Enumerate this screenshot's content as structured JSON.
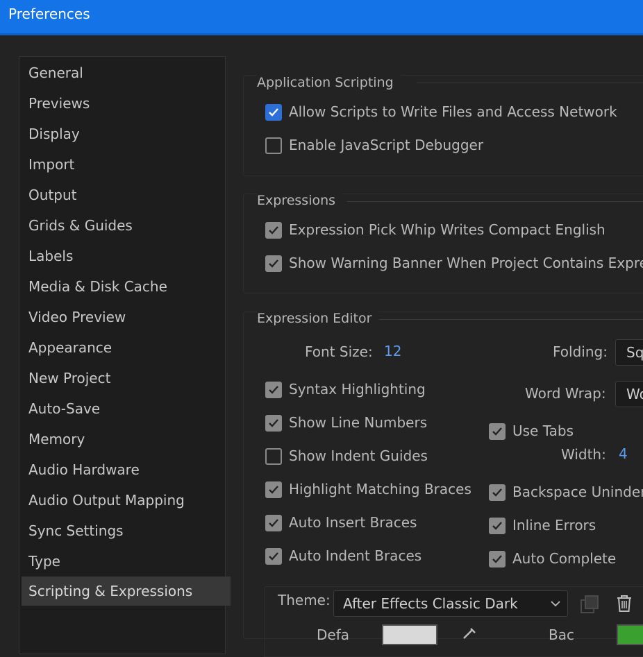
{
  "window": {
    "title": "Preferences"
  },
  "sidebar": {
    "items": [
      {
        "label": "General"
      },
      {
        "label": "Previews"
      },
      {
        "label": "Display"
      },
      {
        "label": "Import"
      },
      {
        "label": "Output"
      },
      {
        "label": "Grids & Guides"
      },
      {
        "label": "Labels"
      },
      {
        "label": "Media & Disk Cache"
      },
      {
        "label": "Video Preview"
      },
      {
        "label": "Appearance"
      },
      {
        "label": "New Project"
      },
      {
        "label": "Auto-Save"
      },
      {
        "label": "Memory"
      },
      {
        "label": "Audio Hardware"
      },
      {
        "label": "Audio Output Mapping"
      },
      {
        "label": "Sync Settings"
      },
      {
        "label": "Type"
      },
      {
        "label": "Scripting & Expressions"
      }
    ],
    "selected": "Scripting & Expressions"
  },
  "application_scripting": {
    "title": "Application Scripting",
    "allow_scripts": {
      "label": "Allow Scripts to Write Files and Access Network",
      "checked": true
    },
    "enable_debugger": {
      "label": "Enable JavaScript Debugger",
      "checked": false
    }
  },
  "expressions": {
    "title": "Expressions",
    "pick_whip": {
      "label": "Expression Pick Whip Writes Compact English",
      "checked": true
    },
    "warning_banner": {
      "label": "Show Warning Banner When Project Contains Expres",
      "checked": true
    }
  },
  "expression_editor": {
    "title": "Expression Editor",
    "font_size_label": "Font Size:",
    "font_size_value": "12",
    "folding_label": "Folding:",
    "folding_value": "Sq",
    "word_wrap_label": "Word Wrap:",
    "word_wrap_value": "Wo",
    "syntax_highlighting": {
      "label": "Syntax Highlighting",
      "checked": true
    },
    "show_line_numbers": {
      "label": "Show Line Numbers",
      "checked": true
    },
    "show_indent_guides": {
      "label": "Show Indent Guides",
      "checked": false
    },
    "highlight_matching_braces": {
      "label": "Highlight Matching Braces",
      "checked": true
    },
    "auto_insert_braces": {
      "label": "Auto Insert Braces",
      "checked": true
    },
    "auto_indent_braces": {
      "label": "Auto Indent Braces",
      "checked": true
    },
    "use_tabs": {
      "label": "Use Tabs",
      "checked": true
    },
    "width_label": "Width:",
    "width_value": "4",
    "backspace_unindent": {
      "label": "Backspace Uninden",
      "checked": true
    },
    "inline_errors": {
      "label": "Inline Errors",
      "checked": true
    },
    "auto_complete": {
      "label": "Auto Complete",
      "checked": true
    },
    "theme_label": "Theme:",
    "theme_value": "After Effects Classic Dark",
    "default_label": "Defa",
    "background_label": "Bac"
  },
  "colors": {
    "accent": "#1473e6",
    "checkbox_blue": "#2d6fd6",
    "value_blue": "#5a9bf2",
    "swatch_default": "#d9d9d9",
    "swatch_green": "#3aa02f"
  }
}
